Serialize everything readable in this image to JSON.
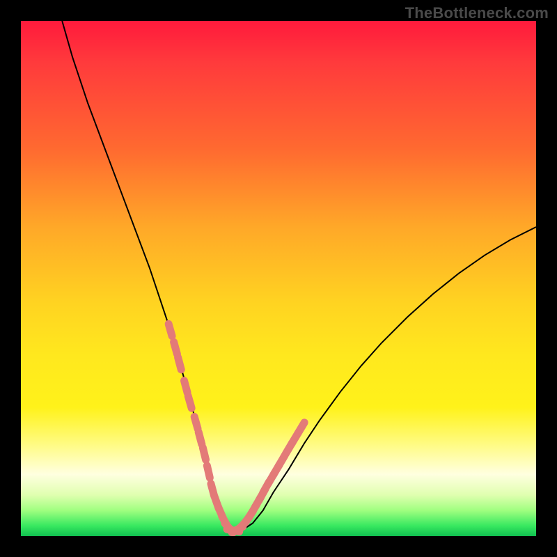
{
  "watermark": "TheBottleneck.com",
  "chart_data": {
    "type": "line",
    "title": "",
    "xlabel": "",
    "ylabel": "",
    "xlim": [
      0,
      100
    ],
    "ylim": [
      0,
      100
    ],
    "series": [
      {
        "name": "curve",
        "x": [
          8,
          10,
          13,
          16,
          19,
          22,
          25,
          27,
          29,
          31,
          33,
          34.5,
          36,
          37.2,
          38.3,
          39.3,
          40.3,
          41.5,
          43,
          45,
          47,
          49,
          52,
          55,
          58,
          62,
          66,
          70,
          75,
          80,
          85,
          90,
          95,
          100
        ],
        "values": [
          100,
          93,
          84,
          76,
          68,
          60,
          52,
          46,
          40,
          33,
          26,
          20,
          14,
          9,
          5.5,
          3,
          1.5,
          1,
          1.2,
          2.5,
          5,
          8.5,
          13,
          18,
          22.5,
          28,
          33,
          37.5,
          42.5,
          47,
          51,
          54.5,
          57.5,
          60
        ]
      }
    ],
    "markers": {
      "name": "highlight",
      "color": "#e37a78",
      "x": [
        29.0,
        30.0,
        30.8,
        32.0,
        32.8,
        34.0,
        34.8,
        35.6,
        36.4,
        37.2,
        38.0,
        38.8,
        39.6,
        40.4,
        41.2,
        42.0,
        42.8,
        43.6,
        44.4,
        45.2,
        46.0,
        46.8,
        47.6,
        48.6,
        49.6,
        50.6,
        52.0,
        53.2,
        54.4
      ],
      "values": [
        40.0,
        36.5,
        33.5,
        29.0,
        26.0,
        22.0,
        19.0,
        16.0,
        12.5,
        9.0,
        6.5,
        4.5,
        2.8,
        1.6,
        1.1,
        1.3,
        1.9,
        2.8,
        3.9,
        5.2,
        6.6,
        8.0,
        9.5,
        11.2,
        12.9,
        14.6,
        17.0,
        19.0,
        21.0
      ]
    }
  }
}
